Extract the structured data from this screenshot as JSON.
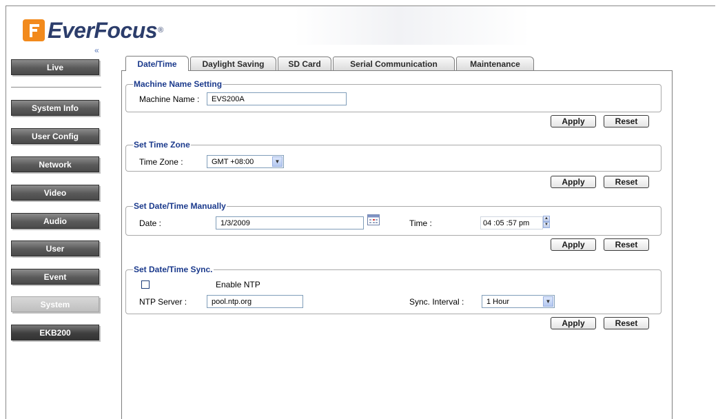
{
  "brand": {
    "name": "EverFocus",
    "registered": "®"
  },
  "sidebar": {
    "collapse": "«",
    "items": [
      {
        "label": "Live"
      },
      {
        "label": "System Info"
      },
      {
        "label": "User Config"
      },
      {
        "label": "Network"
      },
      {
        "label": "Video"
      },
      {
        "label": "Audio"
      },
      {
        "label": "User"
      },
      {
        "label": "Event"
      },
      {
        "label": "System"
      },
      {
        "label": "EKB200"
      }
    ],
    "active": "System"
  },
  "tabs": [
    {
      "label": "Date/Time"
    },
    {
      "label": "Daylight Saving"
    },
    {
      "label": "SD Card"
    },
    {
      "label": "Serial Communication"
    },
    {
      "label": "Maintenance"
    }
  ],
  "sections": {
    "machine": {
      "legend": "Machine Name Setting",
      "label": "Machine Name :",
      "value": "EVS200A"
    },
    "timezone": {
      "legend": "Set Time Zone",
      "label": "Time Zone :",
      "value": "GMT +08:00"
    },
    "manual": {
      "legend": "Set Date/Time Manually",
      "date_label": "Date :",
      "date_value": "1/3/2009",
      "time_label": "Time :",
      "time_value": "04 :05 :57 pm"
    },
    "sync": {
      "legend": "Set Date/Time Sync.",
      "enable_label": "Enable NTP",
      "server_label": "NTP Server :",
      "server_value": "pool.ntp.org",
      "interval_label": "Sync. Interval :",
      "interval_value": "1 Hour"
    }
  },
  "buttons": {
    "apply": "Apply",
    "reset": "Reset"
  },
  "colors": {
    "accent": "#1b3a8c",
    "logo_orange": "#f28a1c",
    "logo_blue": "#2c3d6b"
  }
}
